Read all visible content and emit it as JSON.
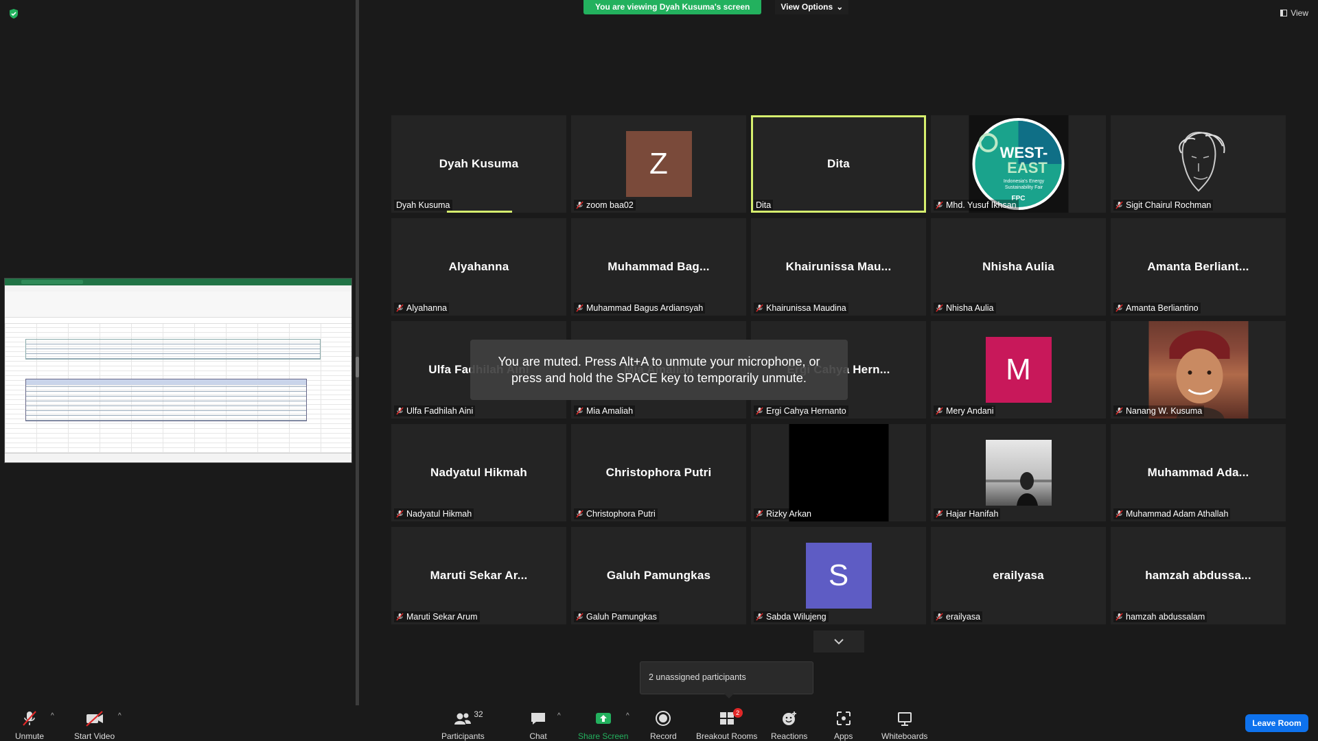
{
  "banner": {
    "viewing_text": "You are viewing Dyah Kusuma's screen",
    "view_options": "View Options",
    "view": "View"
  },
  "tiles": [
    {
      "big": "Dyah Kusuma",
      "label": "Dyah Kusuma",
      "muted": false,
      "active": false,
      "speaking": true,
      "kind": "name"
    },
    {
      "big": "",
      "label": "zoom baa02",
      "muted": true,
      "kind": "letter",
      "letter": "Z",
      "color": "#7a4a3a"
    },
    {
      "big": "Dita",
      "label": "Dita",
      "muted": false,
      "active": true,
      "kind": "name"
    },
    {
      "big": "",
      "label": "Mhd. Yusuf Ikhsan",
      "muted": true,
      "kind": "logo"
    },
    {
      "big": "",
      "label": "Sigit Chairul Rochman",
      "muted": true,
      "kind": "sketch"
    },
    {
      "big": "Alyahanna",
      "label": "Alyahanna",
      "muted": true,
      "kind": "name"
    },
    {
      "big": "Muhammad  Bag...",
      "label": "Muhammad Bagus Ardiansyah",
      "muted": true,
      "kind": "name"
    },
    {
      "big": "Khairunissa  Mau...",
      "label": "Khairunissa Maudina",
      "muted": true,
      "kind": "name"
    },
    {
      "big": "Nhisha Aulia",
      "label": "Nhisha Aulia",
      "muted": true,
      "kind": "name"
    },
    {
      "big": "Amanta  Berliant...",
      "label": "Amanta Berliantino",
      "muted": true,
      "kind": "name"
    },
    {
      "big": "Ulfa Fadhilah Aini",
      "label": "Ulfa Fadhilah Aini",
      "muted": true,
      "kind": "name"
    },
    {
      "big": "Mia Amaliah",
      "label": "Mia Amaliah",
      "muted": true,
      "kind": "name"
    },
    {
      "big": "Ergi Cahya  Hern...",
      "label": "Ergi Cahya Hernanto",
      "muted": true,
      "kind": "name"
    },
    {
      "big": "",
      "label": "Mery Andani",
      "muted": true,
      "kind": "letter",
      "letter": "M",
      "color": "#c8185a"
    },
    {
      "big": "",
      "label": "Nanang W. Kusuma",
      "muted": true,
      "kind": "photo"
    },
    {
      "big": "Nadyatul Hikmah",
      "label": "Nadyatul Hikmah",
      "muted": true,
      "kind": "name"
    },
    {
      "big": "Christophora Putri",
      "label": "Christophora Putri",
      "muted": true,
      "kind": "name"
    },
    {
      "big": "",
      "label": "Rizky Arkan",
      "muted": true,
      "kind": "black"
    },
    {
      "big": "",
      "label": "Hajar Hanifah",
      "muted": true,
      "kind": "bw"
    },
    {
      "big": "Muhammad  Ada...",
      "label": "Muhammad Adam Athallah",
      "muted": true,
      "kind": "name"
    },
    {
      "big": "Maruti  Sekar  Ar...",
      "label": "Maruti Sekar Arum",
      "muted": true,
      "kind": "name"
    },
    {
      "big": "Galuh Pamungkas",
      "label": "Galuh Pamungkas",
      "muted": true,
      "kind": "name"
    },
    {
      "big": "",
      "label": "Sabda Wilujeng",
      "muted": true,
      "kind": "letter",
      "letter": "S",
      "color": "#5e5cc4"
    },
    {
      "big": "erailyasa",
      "label": "erailyasa",
      "muted": true,
      "kind": "name"
    },
    {
      "big": "hamzah  abdussa...",
      "label": "hamzah abdussalam",
      "muted": true,
      "kind": "name"
    }
  ],
  "logo": {
    "line1": "WEST-",
    "line2": "EAST",
    "line3": "Indonesia's Energy",
    "line4": "Sustainability Fair",
    "line5": "FPC"
  },
  "toast": {
    "muted_text": "You are muted. Press Alt+A to unmute your microphone, or press and hold the SPACE key to temporarily unmute."
  },
  "unassigned": "2 unassigned participants",
  "toolbar": {
    "unmute": "Unmute",
    "start_video": "Start Video",
    "participants": "Participants",
    "participants_count": "32",
    "chat": "Chat",
    "share_screen": "Share Screen",
    "record": "Record",
    "breakout_rooms": "Breakout Rooms",
    "breakout_badge": "2",
    "reactions": "Reactions",
    "apps": "Apps",
    "whiteboards": "Whiteboards",
    "leave": "Leave Room"
  },
  "colors": {
    "accent_green": "#23b15e",
    "active_outline": "#d6ef6e",
    "leave_blue": "#0e72ed",
    "mic_red": "#e02828"
  }
}
